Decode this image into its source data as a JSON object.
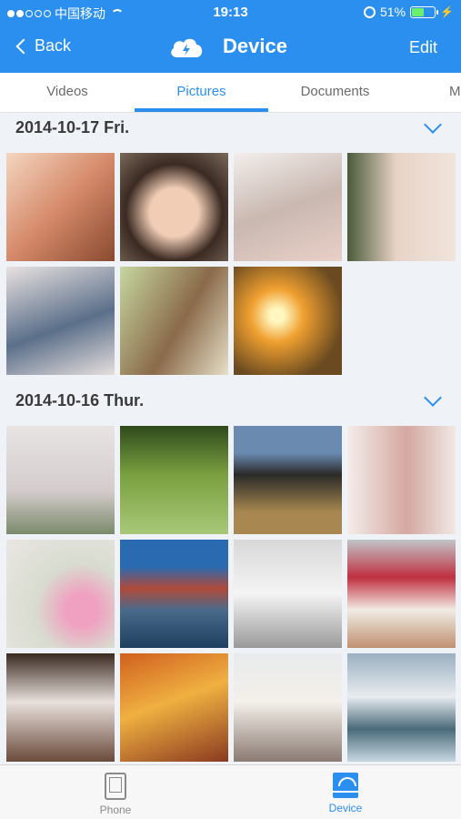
{
  "status_bar": {
    "carrier": "中国移动",
    "time": "19:13",
    "battery": "51%",
    "battery_level": 0.51
  },
  "nav": {
    "back_label": "Back",
    "title": "Device",
    "edit_label": "Edit",
    "icon": "cloud-bolt-icon"
  },
  "tabs": [
    {
      "label": "Videos"
    },
    {
      "label": "Pictures",
      "active": true
    },
    {
      "label": "Documents"
    },
    {
      "label": "M"
    }
  ],
  "sections": [
    {
      "date": "2014-10-17  Fri.",
      "photos": [
        "woman-portrait",
        "girl-leaf",
        "dessert-jar",
        "toddler-pout",
        "girl-blue-dress",
        "woman-field",
        "sunset-road"
      ]
    },
    {
      "date": "2014-10-16  Thur.",
      "photos": [
        "misty-lotus",
        "sunbeam-forest",
        "desert-road",
        "child-window",
        "pink-lotus",
        "harbor-town",
        "child-bunny",
        "berry-parfait",
        "fig-jar",
        "autumn-path",
        "fig-cream",
        "mountain-clouds"
      ]
    }
  ],
  "bottom_tabs": [
    {
      "label": "Phone",
      "icon": "phone-icon"
    },
    {
      "label": "Device",
      "icon": "device-wifi-icon",
      "active": true
    }
  ],
  "colors": {
    "accent": "#2b8ff0"
  }
}
